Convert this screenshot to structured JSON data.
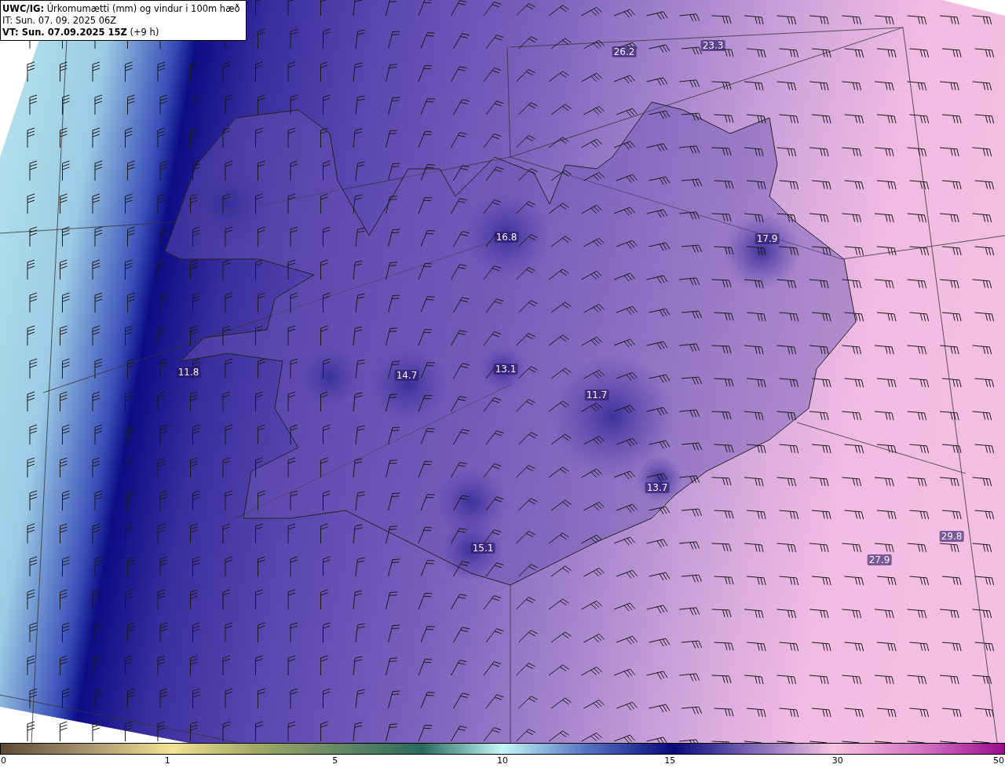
{
  "header": {
    "title": "**UWC/IG:** Úrkomumætti (mm) og vindur i 100m hæð",
    "init_time": "IT: Sun. 07. 09. 2025 06Z",
    "valid_time": "**VT: Sun. 07.09.2025 15Z** (+9 h)"
  },
  "map_labels": [
    {
      "text": "26.2"
    },
    {
      "text": "23.3"
    },
    {
      "text": "16.8"
    },
    {
      "text": "17.9"
    },
    {
      "text": "11.8"
    },
    {
      "text": "14.7"
    },
    {
      "text": "13.1"
    },
    {
      "text": "11.7"
    },
    {
      "text": "13.7"
    },
    {
      "text": "15.1"
    },
    {
      "text": "29.8"
    },
    {
      "text": "27.9"
    }
  ],
  "colorbar": {
    "ticks": [
      "0",
      "1",
      "5",
      "10",
      "15",
      "30",
      "50"
    ]
  }
}
